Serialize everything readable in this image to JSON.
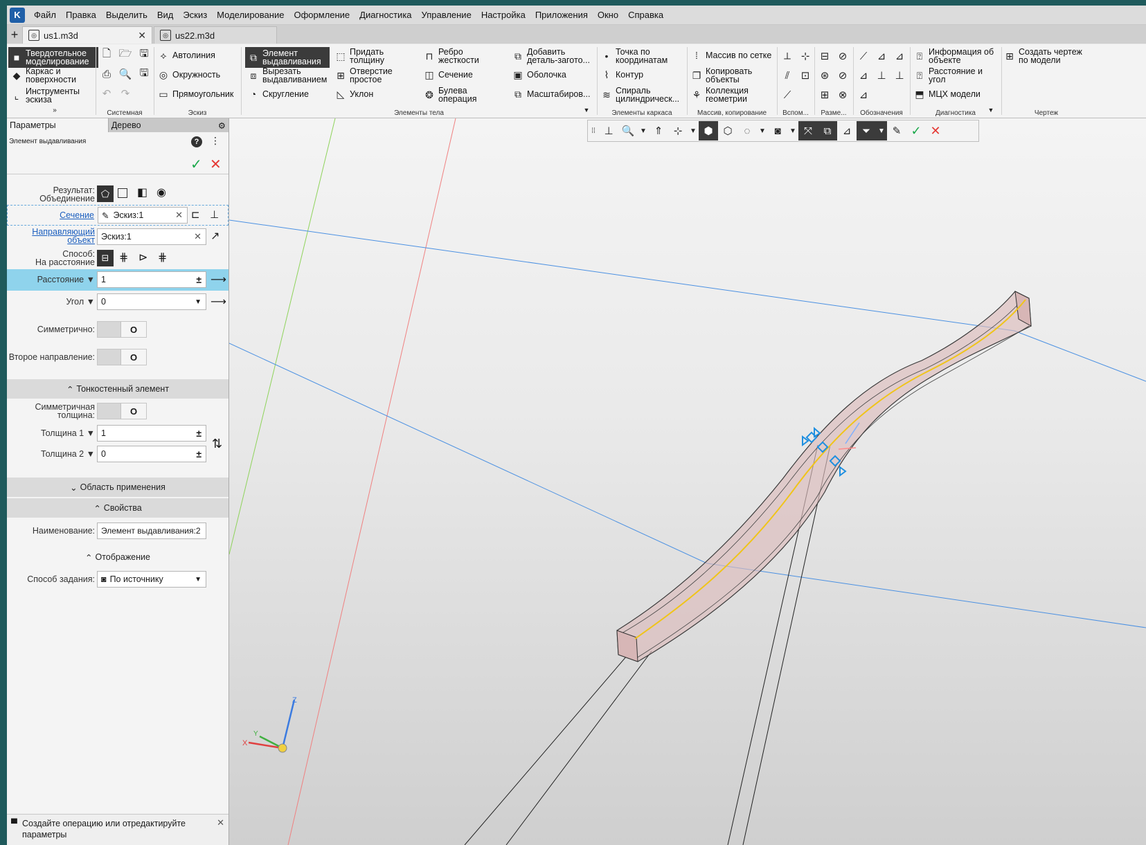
{
  "menu": [
    "Файл",
    "Правка",
    "Выделить",
    "Вид",
    "Эскиз",
    "Моделирование",
    "Оформление",
    "Диагностика",
    "Управление",
    "Настройка",
    "Приложения",
    "Окно",
    "Справка"
  ],
  "tabs": {
    "active": "us1.m3d",
    "inactive": "us22.m3d"
  },
  "ribbon": {
    "modes": [
      "Твердотельное моделирование",
      "Каркас и поверхности",
      "Инструменты эскиза"
    ],
    "eskiz": [
      "Автолиния",
      "Окружность",
      "Прямоугольник"
    ],
    "body_col1": [
      "Элемент выдавливания",
      "Вырезать выдавливанием",
      "Скругление"
    ],
    "body_col2": [
      "Придать толщину",
      "Отверстие простое",
      "Уклон"
    ],
    "body_col3": [
      "Ребро жесткости",
      "Сечение",
      "Булева операция"
    ],
    "body_col4": [
      "Добавить деталь-загото...",
      "Оболочка",
      "Масштабиров..."
    ],
    "wire": [
      "Точка по координатам",
      "Контур",
      "Спираль цилиндрическ..."
    ],
    "mass": [
      "Массив по сетке",
      "Копировать объекты",
      "Коллекция геометрии"
    ],
    "diag": [
      "Информация об объекте",
      "Расстояние и угол",
      "МЦХ модели"
    ],
    "drawing": [
      "Создать чертеж по модели"
    ],
    "groups": [
      "Системная",
      "Эскиз",
      "Элементы тела",
      "Элементы каркаса",
      "Массив, копирование",
      "Вспом...",
      "Разме...",
      "Обозначения",
      "Диагностика",
      "Чертеж"
    ]
  },
  "panel": {
    "tab_params": "Параметры",
    "tab_tree": "Дерево",
    "title": "Элемент выдавливания",
    "result_label": "Результат:",
    "result_value": "Объединение",
    "section_label": "Сечение",
    "section_value": "Эскиз:1",
    "guide_label": "Направляющий объект",
    "guide_value": "Эскиз:1",
    "method_label": "Способ:",
    "method_value": "На расстояние",
    "distance_label": "Расстояние",
    "distance_value": "1",
    "angle_label": "Угол",
    "angle_value": "0",
    "symmetric_label": "Симметрично:",
    "second_dir_label": "Второе направление:",
    "toggle_off": "O",
    "thin_section": "Тонкостенный элемент",
    "sym_thick_label": "Симметричная толщина:",
    "thick1_label": "Толщина 1",
    "thick1_value": "1",
    "thick2_label": "Толщина 2",
    "thick2_value": "0",
    "scope_section": "Область применения",
    "props_section": "Свойства",
    "name_label": "Наименование:",
    "name_value": "Элемент выдавливания:2",
    "display_section": "Отображение",
    "mode_label": "Способ задания:",
    "mode_value": "По источнику",
    "hint": "Создайте операцию или отредактируйте параметры"
  },
  "axes": {
    "x": "X",
    "y": "Y",
    "z": "Z"
  },
  "colors": {
    "accent_row": "#8fd3ec",
    "link": "#1c5fbf",
    "ok": "#1aa84a",
    "cancel": "#e53935",
    "selection": "#1e8fe0",
    "path": "#f0c419"
  }
}
